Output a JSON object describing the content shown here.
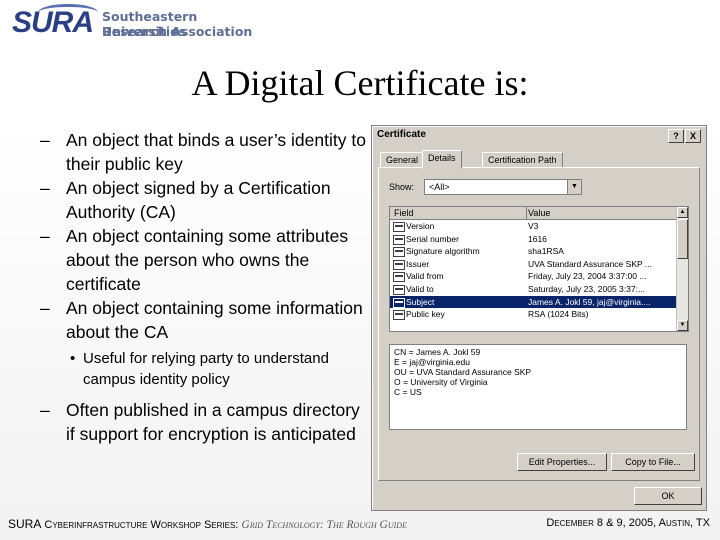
{
  "logo": {
    "mark": "SURA",
    "line1": "Southeastern Universities",
    "line2": "Research Association"
  },
  "title": "A Digital Certificate is:",
  "bullets": [
    {
      "level": 1,
      "marker": "–",
      "text": "An object that binds a user’s identity to their public key"
    },
    {
      "level": 1,
      "marker": "–",
      "text": "An object signed by a Certification Authority (CA)"
    },
    {
      "level": 1,
      "marker": "–",
      "text": "An object containing some attributes about the person who owns the certificate"
    },
    {
      "level": 1,
      "marker": "–",
      "text": "An object containing some information about the CA"
    },
    {
      "level": 2,
      "marker": "•",
      "text": "Useful for relying party to understand campus identity policy"
    },
    {
      "level": 1,
      "marker": "–",
      "text": "Often published in a campus directory if support for encryption is anticipated"
    }
  ],
  "dialog": {
    "title": "Certificate",
    "help_btn": "?",
    "close_btn": "X",
    "tabs": [
      "General",
      "Details",
      "Certification Path"
    ],
    "active_tab": 1,
    "show_label": "Show:",
    "show_value": "<All>",
    "columns": {
      "field": "Field",
      "value": "Value"
    },
    "rows": [
      {
        "field": "Version",
        "value": "V3"
      },
      {
        "field": "Serial number",
        "value": "1616"
      },
      {
        "field": "Signature algorithm",
        "value": "sha1RSA"
      },
      {
        "field": "Issuer",
        "value": "UVA Standard Assurance SKP ..."
      },
      {
        "field": "Valid from",
        "value": "Friday, July 23, 2004 3:37:00 ..."
      },
      {
        "field": "Valid to",
        "value": "Saturday, July 23, 2005 3:37:..."
      },
      {
        "field": "Subject",
        "value": "James A. Jokl 59, jaj@virginia...."
      },
      {
        "field": "Public key",
        "value": "RSA (1024 Bits)"
      }
    ],
    "selected_row": 6,
    "detail_text": "CN = James A. Jokl 59\nE = jaj@virginia.edu\nOU = UVA Standard Assurance SKP\nO = University of Virginia\nC = US",
    "edit_btn": "Edit Properties...",
    "copy_btn": "Copy to File...",
    "ok_btn": "OK"
  },
  "footer": {
    "sura": "SURA",
    "workshop": " Cyberinfrastructure Workshop Series: ",
    "series": "Grid Technology: The Rough Guide",
    "date": "December 8 & 9, 2005, Austin, TX"
  }
}
